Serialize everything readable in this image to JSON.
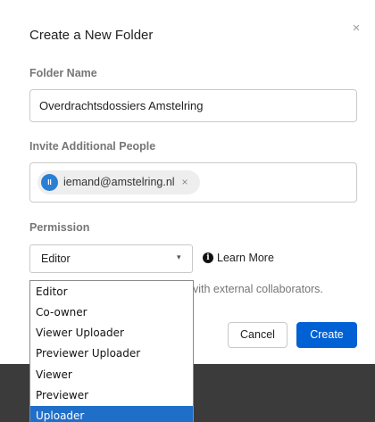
{
  "modal": {
    "title": "Create a New Folder",
    "close_glyph": "×"
  },
  "folder_name": {
    "label": "Folder Name",
    "value": "Overdrachtsdossiers Amstelring"
  },
  "invite": {
    "label": "Invite Additional People",
    "collaborators": [
      {
        "initials": "II",
        "email": "iemand@amstelring.nl",
        "remove_glyph": "×"
      }
    ]
  },
  "permission": {
    "label": "Permission",
    "selected": "Editor",
    "caret_glyph": "▾",
    "info_glyph": "i",
    "learn_more": "Learn More",
    "helper_text_visible": "vith external collaborators."
  },
  "buttons": {
    "cancel": "Cancel",
    "create": "Create"
  },
  "dropdown": {
    "options": [
      "Editor",
      "Co-owner",
      "Viewer Uploader",
      "Previewer Uploader",
      "Viewer",
      "Previewer",
      "Uploader"
    ],
    "highlighted": "Uploader"
  },
  "colors": {
    "accent": "#0061d5",
    "highlight": "#1f6fc9",
    "avatar": "#2a7fd4",
    "backdrop": "#3b3b3b"
  }
}
